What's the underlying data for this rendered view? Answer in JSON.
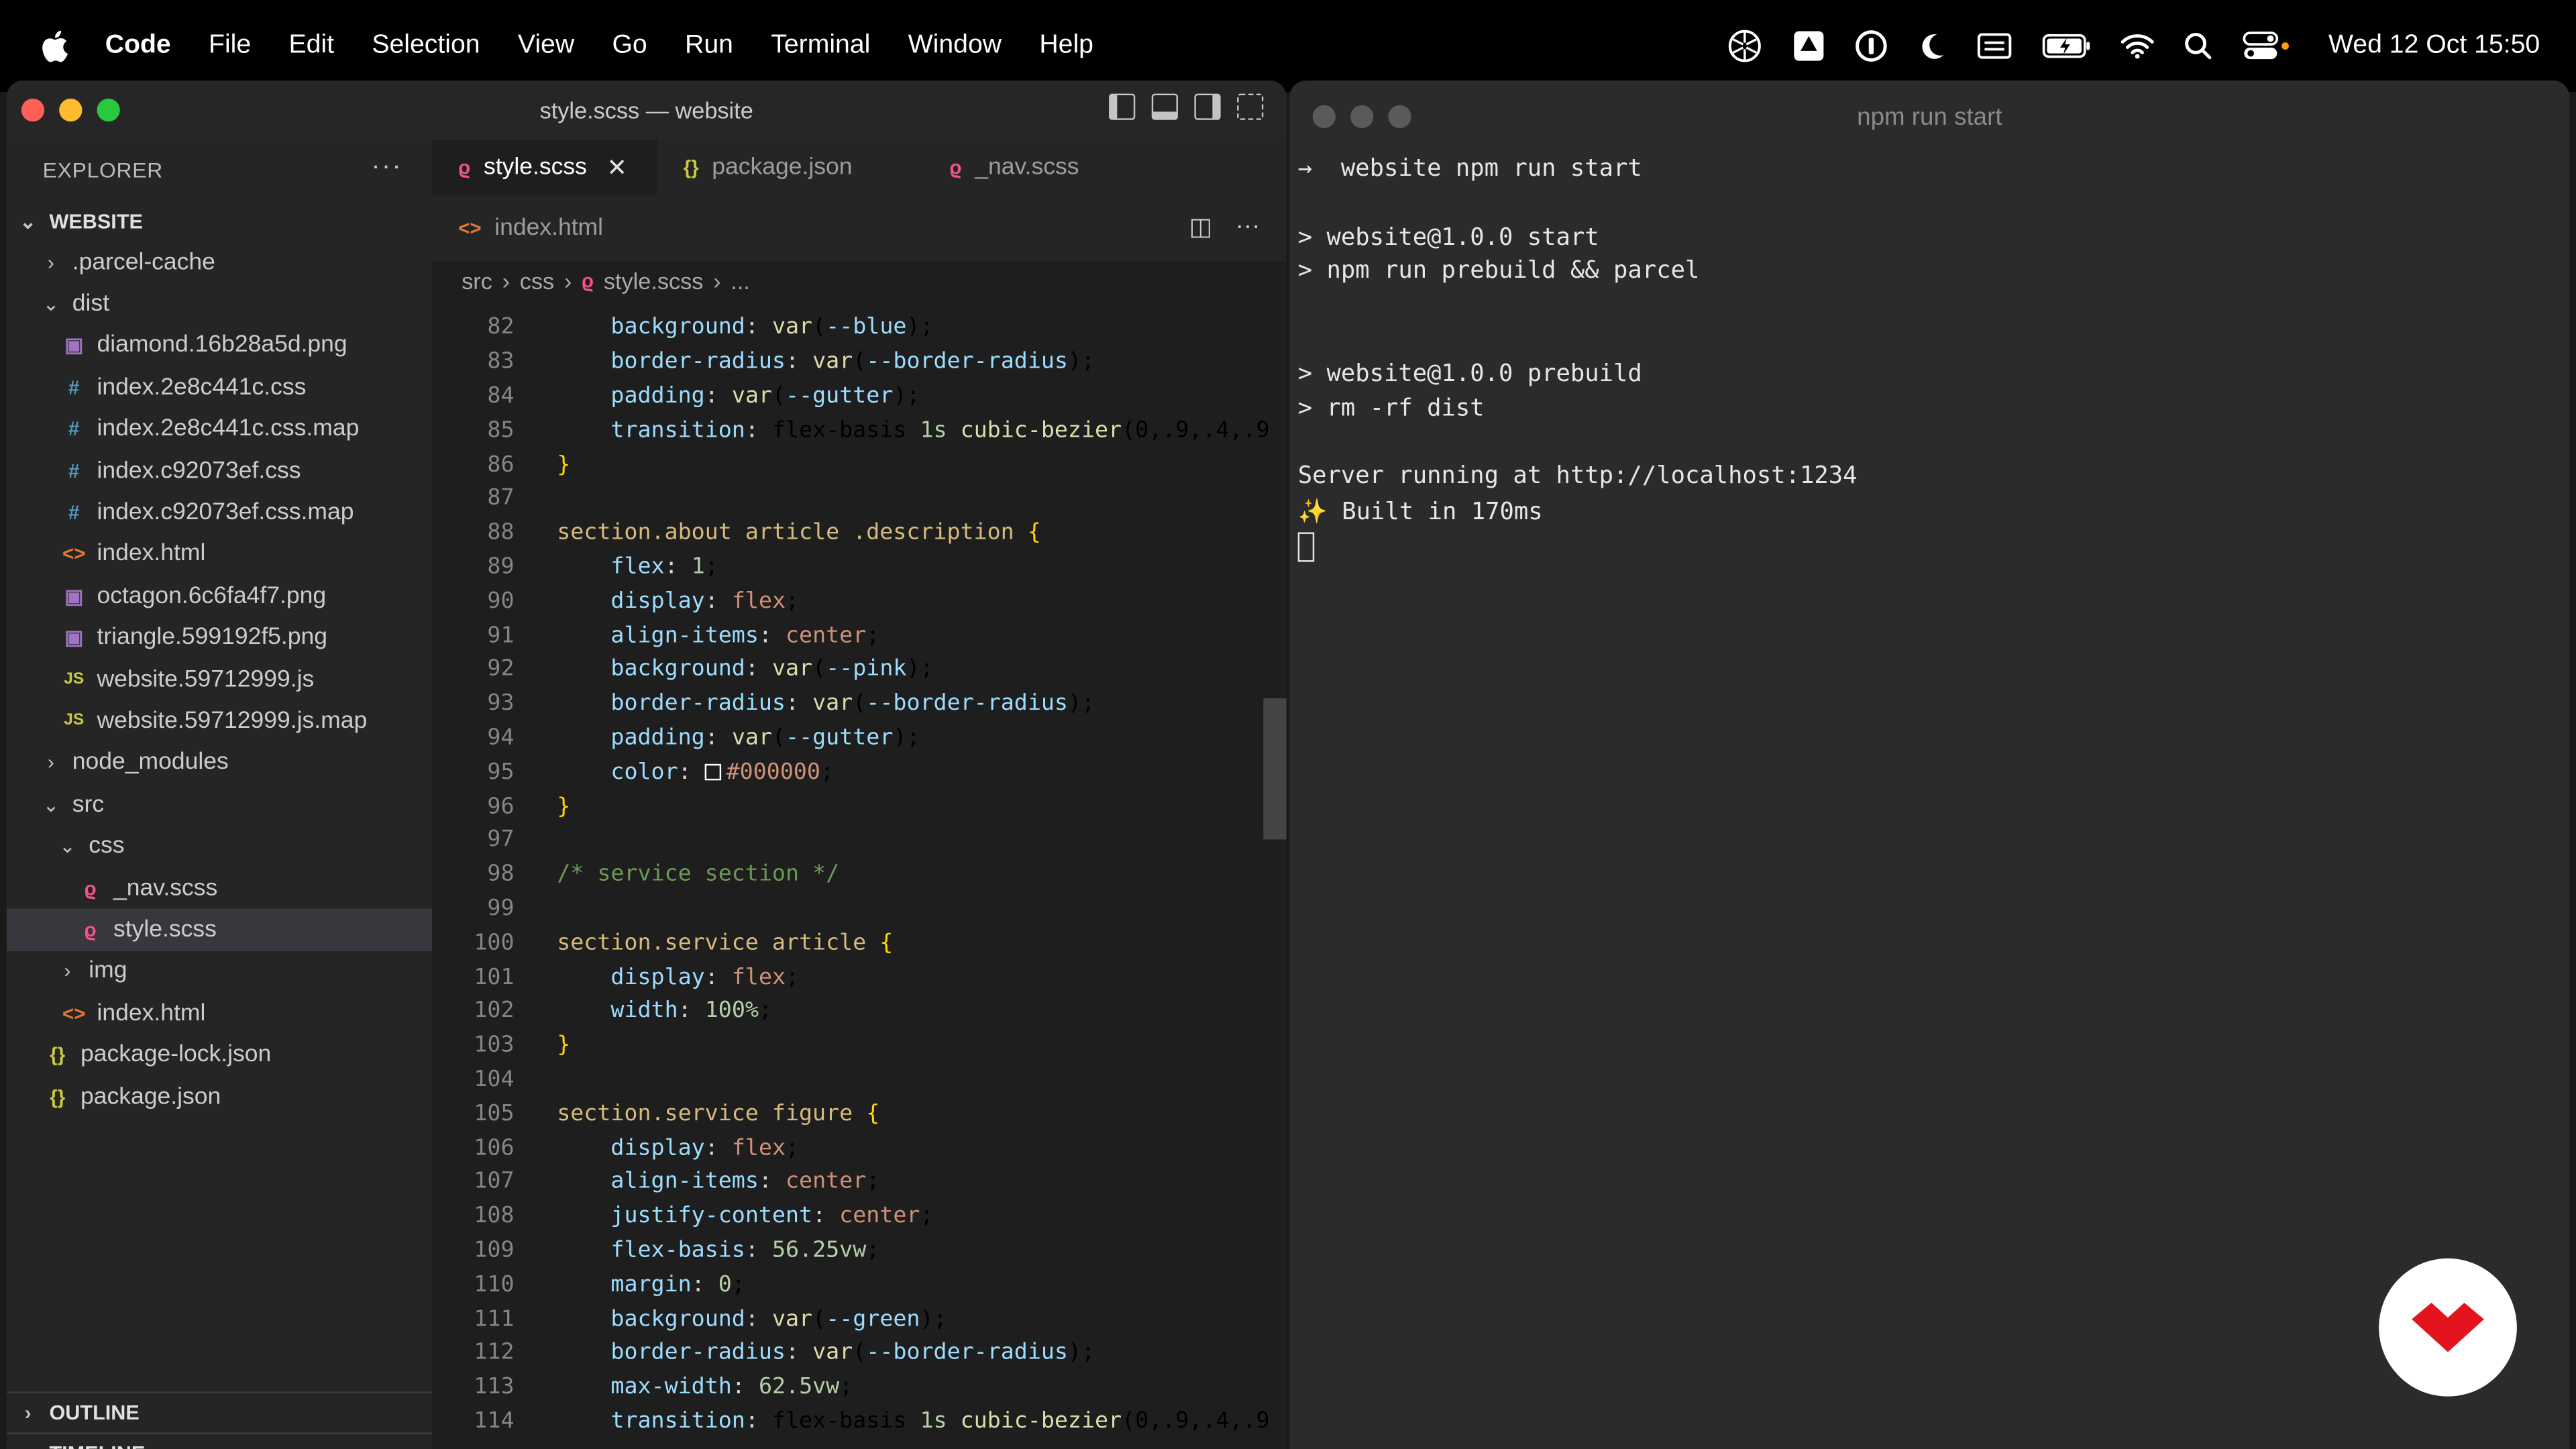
{
  "menubar": {
    "app": "Code",
    "items": [
      "File",
      "Edit",
      "Selection",
      "View",
      "Go",
      "Run",
      "Terminal",
      "Window",
      "Help"
    ],
    "clock": "Wed 12 Oct  15:50"
  },
  "vscode": {
    "title": "style.scss — website",
    "explorer_label": "EXPLORER",
    "explorer_menu": "···",
    "root_label": "WEBSITE",
    "tree": [
      {
        "label": ".parcel-cache",
        "kind": "folder",
        "depth": 1,
        "open": false
      },
      {
        "label": "dist",
        "kind": "folder",
        "depth": 1,
        "open": true
      },
      {
        "label": "diamond.16b28a5d.png",
        "kind": "png",
        "depth": 2
      },
      {
        "label": "index.2e8c441c.css",
        "kind": "css",
        "depth": 2
      },
      {
        "label": "index.2e8c441c.css.map",
        "kind": "css",
        "depth": 2
      },
      {
        "label": "index.c92073ef.css",
        "kind": "css",
        "depth": 2
      },
      {
        "label": "index.c92073ef.css.map",
        "kind": "css",
        "depth": 2
      },
      {
        "label": "index.html",
        "kind": "html",
        "depth": 2
      },
      {
        "label": "octagon.6c6fa4f7.png",
        "kind": "png",
        "depth": 2
      },
      {
        "label": "triangle.599192f5.png",
        "kind": "png",
        "depth": 2
      },
      {
        "label": "website.59712999.js",
        "kind": "js",
        "depth": 2
      },
      {
        "label": "website.59712999.js.map",
        "kind": "js",
        "depth": 2
      },
      {
        "label": "node_modules",
        "kind": "folder",
        "depth": 1,
        "open": false
      },
      {
        "label": "src",
        "kind": "folder",
        "depth": 1,
        "open": true
      },
      {
        "label": "css",
        "kind": "folder",
        "depth": 2,
        "open": true
      },
      {
        "label": "_nav.scss",
        "kind": "scss",
        "depth": 3
      },
      {
        "label": "style.scss",
        "kind": "scss",
        "depth": 3,
        "selected": true
      },
      {
        "label": "img",
        "kind": "folder",
        "depth": 2,
        "open": false
      },
      {
        "label": "index.html",
        "kind": "html",
        "depth": 2
      },
      {
        "label": "package-lock.json",
        "kind": "json",
        "depth": 1
      },
      {
        "label": "package.json",
        "kind": "json",
        "depth": 1
      }
    ],
    "outline_label": "OUTLINE",
    "timeline_label": "TIMELINE",
    "tabs": [
      {
        "label": "style.scss",
        "kind": "scss",
        "active": true
      },
      {
        "label": "package.json",
        "kind": "json"
      },
      {
        "label": "_nav.scss",
        "kind": "scss"
      }
    ],
    "tabs_row2": [
      {
        "label": "index.html",
        "kind": "html"
      }
    ],
    "close_glyph": "✕",
    "breadcrumb": [
      "src",
      "css",
      "style.scss",
      "..."
    ],
    "code_lines": [
      {
        "n": "82",
        "t": "    background: var(--blue);"
      },
      {
        "n": "83",
        "t": "    border-radius: var(--border-radius);"
      },
      {
        "n": "84",
        "t": "    padding: var(--gutter);"
      },
      {
        "n": "85",
        "t": "    transition: flex-basis 1s cubic-bezier(0,.9,.4,.9"
      },
      {
        "n": "86",
        "t": "}"
      },
      {
        "n": "87",
        "t": ""
      },
      {
        "n": "88",
        "t": "section.about article .description {"
      },
      {
        "n": "89",
        "t": "    flex: 1;"
      },
      {
        "n": "90",
        "t": "    display: flex;"
      },
      {
        "n": "91",
        "t": "    align-items: center;"
      },
      {
        "n": "92",
        "t": "    background: var(--pink);"
      },
      {
        "n": "93",
        "t": "    border-radius: var(--border-radius);"
      },
      {
        "n": "94",
        "t": "    padding: var(--gutter);"
      },
      {
        "n": "95",
        "t": "    color: #000000;"
      },
      {
        "n": "96",
        "t": "}"
      },
      {
        "n": "97",
        "t": ""
      },
      {
        "n": "98",
        "t": "/* service section */"
      },
      {
        "n": "99",
        "t": ""
      },
      {
        "n": "100",
        "t": "section.service article {"
      },
      {
        "n": "101",
        "t": "    display: flex;"
      },
      {
        "n": "102",
        "t": "    width: 100%;"
      },
      {
        "n": "103",
        "t": "}"
      },
      {
        "n": "104",
        "t": ""
      },
      {
        "n": "105",
        "t": "section.service figure {"
      },
      {
        "n": "106",
        "t": "    display: flex;"
      },
      {
        "n": "107",
        "t": "    align-items: center;"
      },
      {
        "n": "108",
        "t": "    justify-content: center;"
      },
      {
        "n": "109",
        "t": "    flex-basis: 56.25vw;"
      },
      {
        "n": "110",
        "t": "    margin: 0;"
      },
      {
        "n": "111",
        "t": "    background: var(--green);"
      },
      {
        "n": "112",
        "t": "    border-radius: var(--border-radius);"
      },
      {
        "n": "113",
        "t": "    max-width: 62.5vw;"
      },
      {
        "n": "114",
        "t": "    transition: flex-basis 1s cubic-bezier(0,.9,.4,.9"
      }
    ]
  },
  "terminal": {
    "title": "npm run start",
    "lines": [
      "→  website npm run start",
      "",
      "> website@1.0.0 start",
      "> npm run prebuild && parcel",
      "",
      "",
      "> website@1.0.0 prebuild",
      "> rm -rf dist",
      "",
      "Server running at http://localhost:1234",
      "✨ Built in 170ms"
    ]
  },
  "colors": {
    "accent_logo": "#e3141e",
    "editor_bg": "#1e1e1e",
    "terminal_bg": "#2b2b2d"
  }
}
